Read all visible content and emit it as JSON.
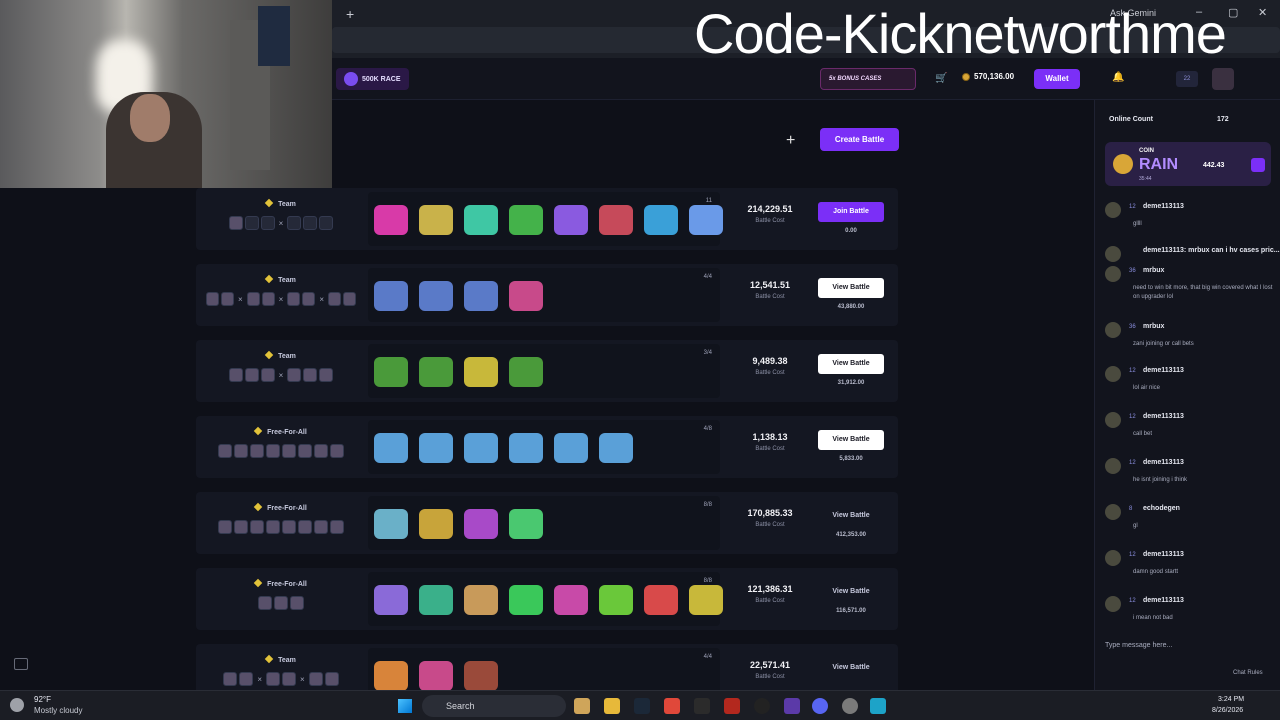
{
  "browser": {
    "new_tab_label": "+",
    "ask_label": "Ask Gemini",
    "window_controls": [
      "–",
      "▢",
      "✕"
    ]
  },
  "overlay": {
    "text": "Code-Kicknetworthme"
  },
  "nav": {
    "race_label": "500K RACE",
    "bonus_label": "5x BONUS CASES",
    "balance": "570,136.00",
    "wallet_label": "Wallet",
    "level": "22"
  },
  "main": {
    "create_label": "Create Battle",
    "cost_label": "Battle Cost",
    "battles": [
      {
        "mode": "Team",
        "round": "11",
        "cost": "214,229.51",
        "button": "Join Battle",
        "style": "purple",
        "prize": "0.00"
      },
      {
        "mode": "Team",
        "round": "4/4",
        "cost": "12,541.51",
        "button": "View Battle",
        "style": "white",
        "prize": "43,880.00"
      },
      {
        "mode": "Team",
        "round": "3/4",
        "cost": "9,489.38",
        "button": "View Battle",
        "style": "white",
        "prize": "31,912.00"
      },
      {
        "mode": "Free-For-All",
        "round": "4/8",
        "cost": "1,138.13",
        "button": "View Battle",
        "style": "white",
        "prize": "5,833.00"
      },
      {
        "mode": "Free-For-All",
        "round": "8/8",
        "cost": "170,885.33",
        "button": "View Battle",
        "style": "dark",
        "prize": "412,353.00"
      },
      {
        "mode": "Free-For-All",
        "round": "8/8",
        "cost": "121,386.31",
        "button": "View Battle",
        "style": "dark",
        "prize": "116,571.00"
      },
      {
        "mode": "Team",
        "round": "4/4",
        "cost": "22,571.41",
        "button": "View Battle",
        "style": "dark",
        "prize": ""
      }
    ]
  },
  "chat": {
    "online_label": "Online Count",
    "online_count": "172",
    "rain_coin": "COIN",
    "rain_label": "RAIN",
    "rain_timer": "35:44",
    "rain_amount": "442.43",
    "messages": [
      {
        "level": "12",
        "name": "deme113113",
        "text": "gllll"
      },
      {
        "level": "",
        "name": "deme113113: mrbux can i hv cases pric...",
        "text": ""
      },
      {
        "level": "36",
        "name": "mrbux",
        "text": "need to win bit more, that big win covered what I lost on upgrader lol"
      },
      {
        "level": "36",
        "name": "mrbux",
        "text": "zani joining or call bets"
      },
      {
        "level": "12",
        "name": "deme113113",
        "text": "lol air nice"
      },
      {
        "level": "12",
        "name": "deme113113",
        "text": "call bet"
      },
      {
        "level": "12",
        "name": "deme113113",
        "text": "he isnt joining i think"
      },
      {
        "level": "8",
        "name": "echodegen",
        "text": "gl"
      },
      {
        "level": "12",
        "name": "deme113113",
        "text": "damn good startt"
      },
      {
        "level": "12",
        "name": "deme113113",
        "text": "i mean not bad"
      }
    ],
    "input_placeholder": "Type message here...",
    "rules_label": "Chat Rules"
  },
  "taskbar": {
    "temp": "92°F",
    "weather": "Mostly cloudy",
    "search_label": "Search",
    "time": "3:24 PM",
    "date": "8/26/2026"
  },
  "colors": {
    "accent": "#7b2ff7",
    "coin": "#d9a637",
    "background": "#0e1018"
  }
}
